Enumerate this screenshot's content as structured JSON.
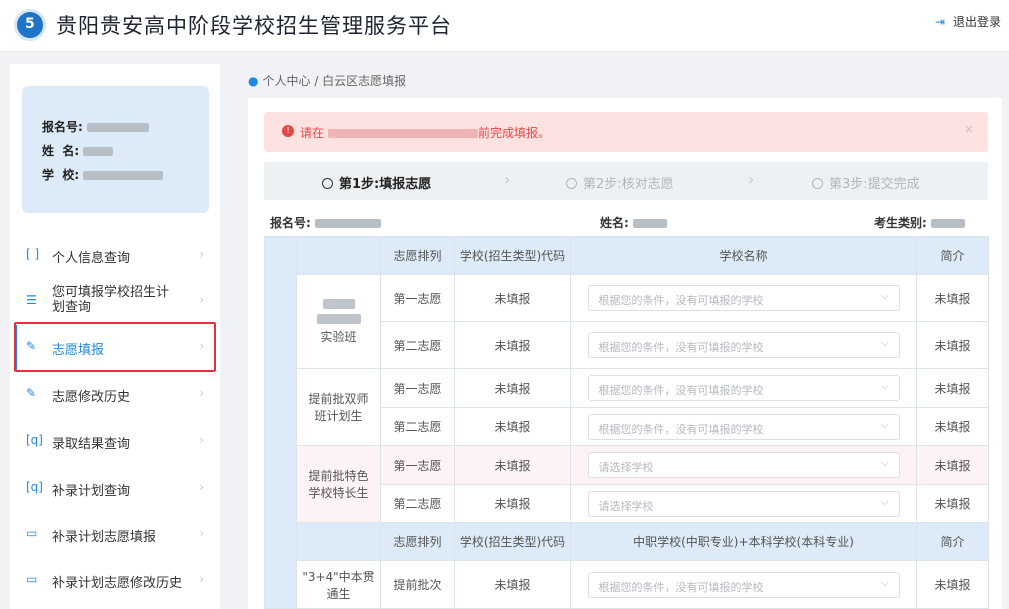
{
  "header": {
    "title": "贵阳贵安高中阶段学校招生管理服务平台",
    "logout": "退出登录"
  },
  "user": {
    "reg_label": "报名号:",
    "name_label": "姓  名:",
    "school_label": "学  校:"
  },
  "sidebar": {
    "items": [
      {
        "label": "个人信息查询",
        "icon": "scan-user-icon"
      },
      {
        "label": "您可填报学校招生计划查询",
        "icon": "list-search-icon"
      },
      {
        "label": "志愿填报",
        "icon": "edit-pen-icon",
        "active": true
      },
      {
        "label": "志愿修改历史",
        "icon": "edit-pen-icon"
      },
      {
        "label": "录取结果查询",
        "icon": "scan-search-icon"
      },
      {
        "label": "补录计划查询",
        "icon": "scan-search-icon"
      },
      {
        "label": "补录计划志愿填报",
        "icon": "form-icon"
      },
      {
        "label": "补录计划志愿修改历史",
        "icon": "form-icon"
      }
    ]
  },
  "breadcrumb": [
    "个人中心",
    "白云区志愿填报"
  ],
  "alert": {
    "prefix": "请在",
    "suffix": "前完成填报。",
    "close": "×"
  },
  "steps": [
    {
      "label": "第1步:填报志愿",
      "current": true
    },
    {
      "label": "第2步:核对志愿",
      "current": false
    },
    {
      "label": "第3步:提交完成",
      "current": false
    }
  ],
  "info": {
    "reg_label": "报名号:",
    "name_label": "姓名:",
    "cat_label": "考生类别:"
  },
  "table": {
    "headers": [
      "志愿排列",
      "学校(招生类型)代码",
      "学校名称",
      "简介"
    ],
    "groups": [
      {
        "name": "实验班",
        "rows": [
          {
            "rank": "第一志愿",
            "code": "未填报",
            "placeholder": "根据您的条件，没有可填报的学校",
            "intro": "未填报"
          },
          {
            "rank": "第二志愿",
            "code": "未填报",
            "placeholder": "根据您的条件，没有可填报的学校",
            "intro": "未填报"
          }
        ]
      },
      {
        "name": "提前批双师班计划生",
        "rows": [
          {
            "rank": "第一志愿",
            "code": "未填报",
            "placeholder": "根据您的条件，没有可填报的学校",
            "intro": "未填报"
          },
          {
            "rank": "第二志愿",
            "code": "未填报",
            "placeholder": "根据您的条件，没有可填报的学校",
            "intro": "未填报"
          }
        ]
      },
      {
        "name": "提前批特色学校特长生",
        "rows": [
          {
            "rank": "第一志愿",
            "code": "未填报",
            "placeholder": "请选择学校",
            "intro": "未填报"
          },
          {
            "rank": "第二志愿",
            "code": "未填报",
            "placeholder": "请选择学校",
            "intro": "未填报"
          }
        ]
      }
    ],
    "headers2": [
      "志愿排列",
      "学校(招生类型)代码",
      "中职学校(中职专业)+本科学校(本科专业)",
      "简介"
    ],
    "group4": {
      "name": "\"3+4\"中本贯通生",
      "row": {
        "rank": "提前批次",
        "code": "未填报",
        "placeholder": "根据您的条件，没有可填报的学校",
        "intro": "未填报"
      }
    }
  },
  "colors": {
    "accent": "#1e88e5",
    "alert": "#e94545",
    "highlight": "#e2313f"
  }
}
